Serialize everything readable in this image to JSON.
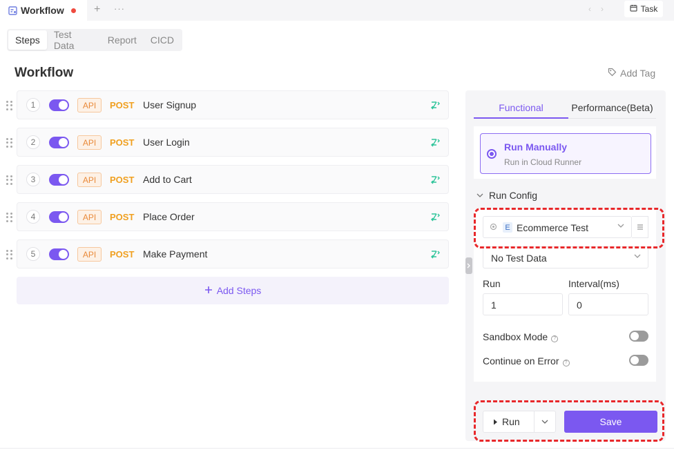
{
  "tabbar": {
    "title": "Workflow",
    "add": "+",
    "more": "···",
    "task_label": "Task",
    "prev": "‹",
    "next": "›"
  },
  "subtabs": [
    "Steps",
    "Test Data",
    "Report",
    "CICD"
  ],
  "page": {
    "title": "Workflow",
    "add_tag": "Add Tag"
  },
  "steps": [
    {
      "num": "1",
      "badge": "API",
      "method": "POST",
      "name": "User Signup",
      "enabled": true
    },
    {
      "num": "2",
      "badge": "API",
      "method": "POST",
      "name": "User Login",
      "enabled": true
    },
    {
      "num": "3",
      "badge": "API",
      "method": "POST",
      "name": "Add to Cart",
      "enabled": true
    },
    {
      "num": "4",
      "badge": "API",
      "method": "POST",
      "name": "Place Order",
      "enabled": true
    },
    {
      "num": "5",
      "badge": "API",
      "method": "POST",
      "name": "Make Payment",
      "enabled": true
    }
  ],
  "add_steps": "Add Steps",
  "panel": {
    "tabs": [
      "Functional",
      "Performance(Beta)"
    ],
    "run_mode": {
      "title": "Run Manually",
      "subtitle": "Run in Cloud Runner"
    },
    "run_config": "Run Config",
    "environment": {
      "badge": "E",
      "label": "Ecommerce Test"
    },
    "test_data": "No Test Data",
    "run_label": "Run",
    "run_value": "1",
    "interval_label": "Interval(ms)",
    "interval_value": "0",
    "sandbox_mode": "Sandbox Mode",
    "continue_on_error": "Continue on Error",
    "info_glyph": "?",
    "run_button": "Run",
    "save_button": "Save"
  },
  "colors": {
    "accent": "#7b58f0",
    "method": "#f0a020",
    "api_badge": "#e98a3a",
    "highlight": "#e8282b"
  }
}
